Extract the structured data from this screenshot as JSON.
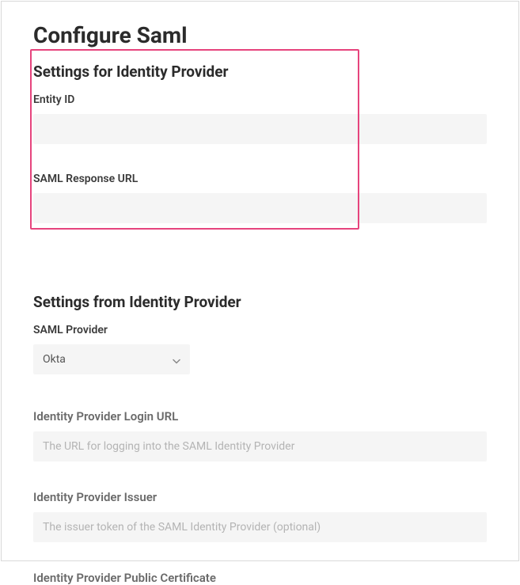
{
  "page_title": "Configure Saml",
  "section_for": {
    "title": "Settings for Identity Provider",
    "entity_id_label": "Entity ID",
    "entity_id_value": "",
    "response_url_label": "SAML Response URL",
    "response_url_value": ""
  },
  "section_from": {
    "title": "Settings from Identity Provider",
    "provider_label": "SAML Provider",
    "provider_value": "Okta",
    "login_url_label": "Identity Provider Login URL",
    "login_url_value": "",
    "login_url_placeholder": "The URL for logging into the SAML Identity Provider",
    "issuer_label": "Identity Provider Issuer",
    "issuer_value": "",
    "issuer_placeholder": "The issuer token of the SAML Identity Provider (optional)",
    "cert_label": "Identity Provider Public Certificate"
  }
}
